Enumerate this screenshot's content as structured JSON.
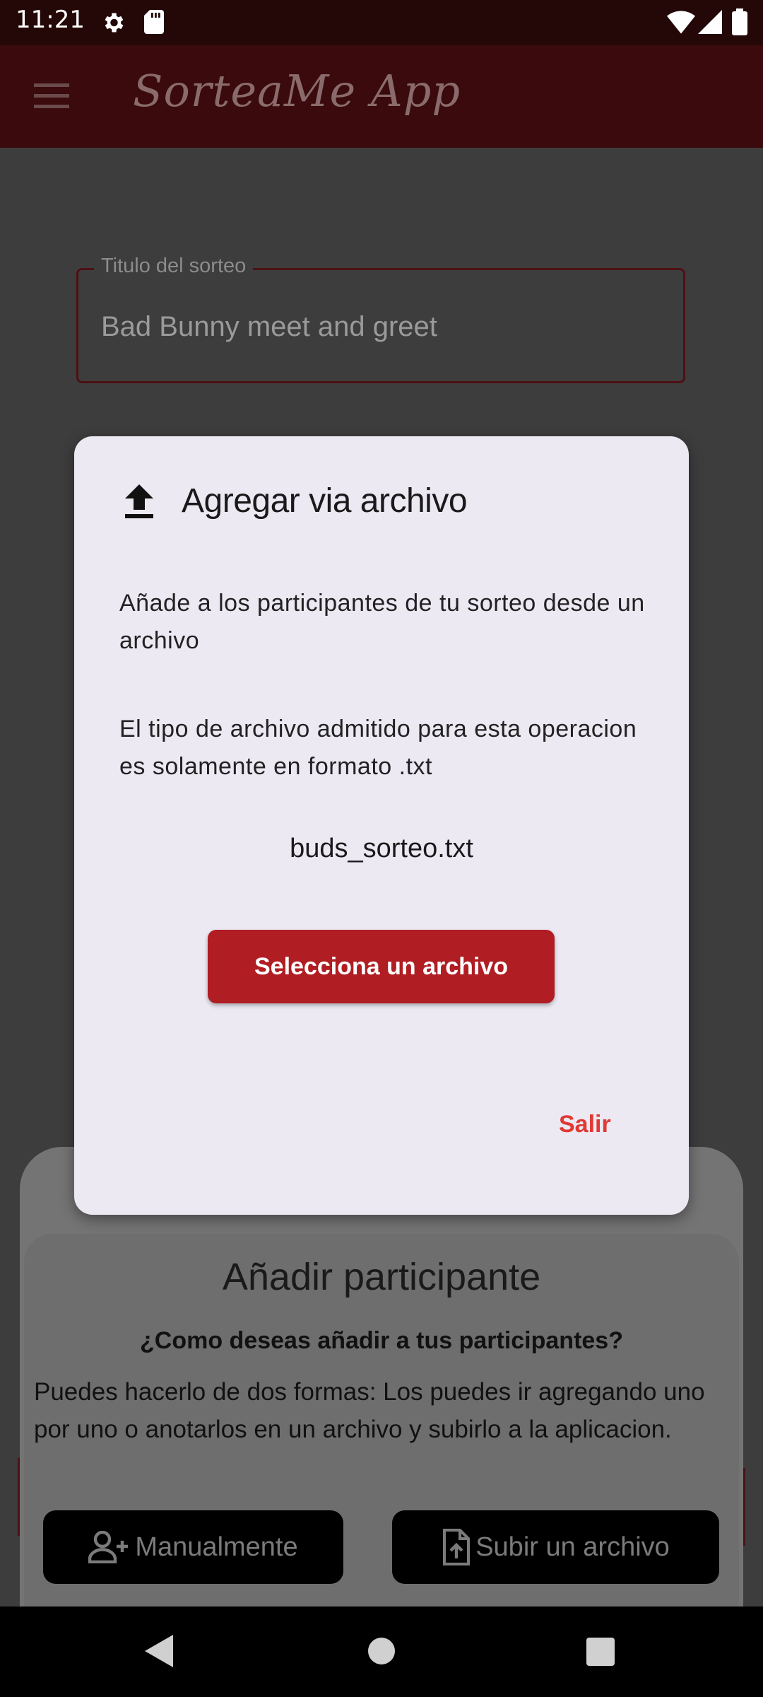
{
  "status_bar": {
    "time": "11:21"
  },
  "app_bar": {
    "title": "SorteaMe App"
  },
  "raffle_title_field": {
    "label": "Titulo del sorteo",
    "value": "Bad Bunny meet and greet"
  },
  "dialog": {
    "title": "Agregar via archivo",
    "paragraph_1": "Añade a los participantes de tu sorteo desde un archivo",
    "paragraph_2": "El tipo de archivo admitido para esta operacion es solamente en formato .txt",
    "file_name": "buds_sorteo.txt",
    "select_button": "Selecciona un archivo",
    "exit_button": "Salir"
  },
  "bottom_sheet": {
    "title": "Añadir participante",
    "subtitle": "¿Como deseas añadir a tus participantes?",
    "description": "Puedes hacerlo de dos formas: Los puedes ir agregando uno por uno o anotarlos en un archivo y subirlo a la aplicacion.",
    "manual_button": "Manualmente",
    "upload_button": "Subir un archivo"
  },
  "colors": {
    "app_bar": "#3a0a0c",
    "accent": "#b01d23",
    "exit_text": "#e03a35",
    "dialog_bg": "#ece9f3"
  }
}
